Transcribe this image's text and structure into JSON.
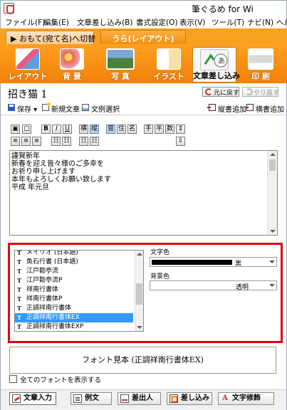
{
  "window": {
    "title": "筆ぐるめ for Wi"
  },
  "menubar": {
    "items": [
      "ファイル(F)",
      "編集(E)",
      "文章差し込み(B)",
      "書式設定(O)",
      "表示(V)",
      "ツール(T)",
      "ナビ(N)",
      "ヘル"
    ]
  },
  "mode_tabs": {
    "front": "▶ おもて(宛て名)へ切替",
    "back": "うら(レイアウト)"
  },
  "ribbon": {
    "buttons": [
      "レイアウト",
      "背 景",
      "写 真",
      "イラスト",
      "文章差し込み",
      "印 刷"
    ],
    "active": "文章差し込み"
  },
  "document": {
    "title": "招き猫  1",
    "undo_label": "元に戻す",
    "redo_label": "やり直す"
  },
  "commands": {
    "save": "保存",
    "new_text": "新規文章",
    "select_text": "文例選択",
    "add_vertical": "縦書追加",
    "add_horizontal": "横書追加"
  },
  "format_toolbar": {
    "row1": [
      "横",
      "縦",
      "音",
      "住",
      "名",
      "手",
      "半",
      "数"
    ],
    "bold": "B",
    "italic": "I",
    "underline": "U"
  },
  "text_content": {
    "lines": [
      "謹賀新年",
      "新春を迎え皆々様のご多幸を",
      "お祈り申し上げます",
      "本年もよろしくお願い致します",
      "平成  年元旦"
    ]
  },
  "font_panel": {
    "fonts": [
      "メイリオ (日本語)",
      "魚石行書 (日本語)",
      "江戸勘亭流",
      "江戸勘亭流P",
      "祥南行書体",
      "祥南行書体P",
      "正調祥南行書体",
      "正調祥南行書体EX",
      "正調祥南行書体EXP"
    ],
    "selected_font": "正調祥南行書体EX",
    "text_color_label": "文字色",
    "text_color_value": "黒",
    "text_color_swatch": "#000000",
    "bg_color_label": "背景色",
    "bg_color_value": "透明"
  },
  "preview": {
    "text": "フォント見本 (正調祥南行書体EX)"
  },
  "show_all_fonts": {
    "label": "全てのフォントを表示する",
    "checked": false
  },
  "bottom_tabs": {
    "items": [
      "文章入力",
      "例文",
      "差出人",
      "差し込み",
      "文字修飾"
    ],
    "active": "文章入力"
  },
  "colors": {
    "ribbon_orange": "#f08008",
    "highlight_red": "#e00010",
    "selection_blue": "#3399ff"
  }
}
